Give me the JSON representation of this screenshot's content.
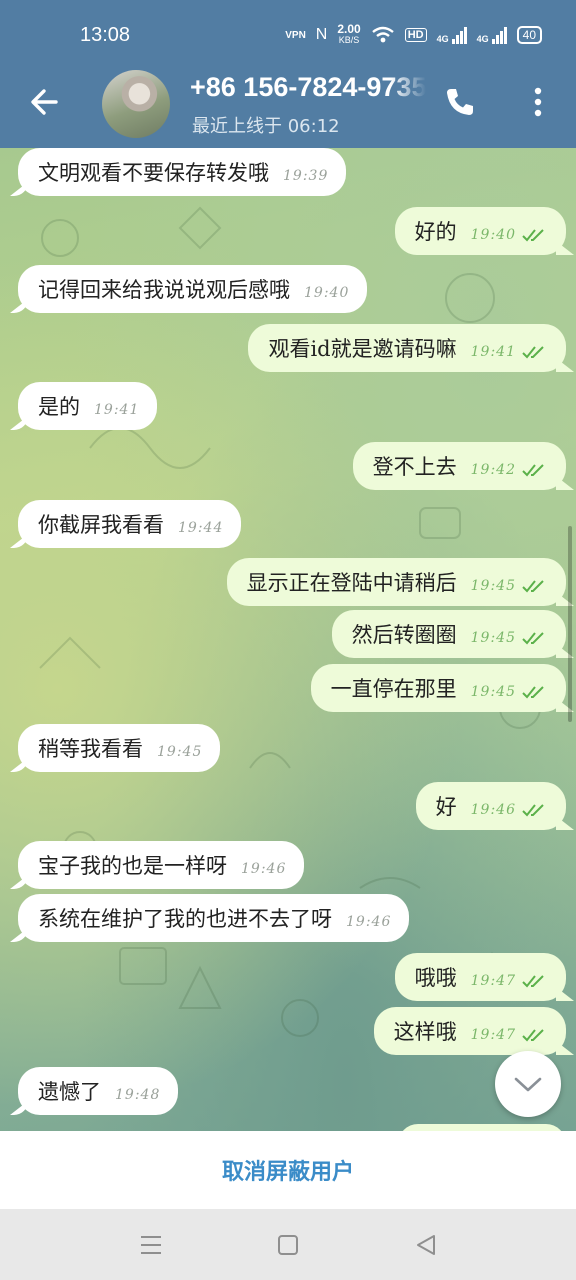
{
  "status": {
    "time": "13:08",
    "vpn": "VPN",
    "nfc": "N",
    "speed_value": "2.00",
    "speed_unit": "KB/S",
    "hd": "HD",
    "net1": "4G",
    "net2": "4G",
    "battery": "40"
  },
  "header": {
    "title": "+86 156-7824-9735",
    "subtitle": "最近上线于 06:12"
  },
  "messages": [
    {
      "dir": "in",
      "text": "文明观看不要保存转发哦",
      "time": "19:39"
    },
    {
      "dir": "out",
      "text": "好的",
      "time": "19:40",
      "read": true
    },
    {
      "dir": "in",
      "text": "记得回来给我说说观后感哦",
      "time": "19:40"
    },
    {
      "dir": "out",
      "text": "观看id就是邀请码嘛",
      "time": "19:41",
      "read": true
    },
    {
      "dir": "in",
      "text": "是的",
      "time": "19:41"
    },
    {
      "dir": "out",
      "text": "登不上去",
      "time": "19:42",
      "read": true
    },
    {
      "dir": "in",
      "text": "你截屏我看看",
      "time": "19:44"
    },
    {
      "dir": "out",
      "text": "显示正在登陆中请稍后",
      "time": "19:45",
      "read": true
    },
    {
      "dir": "out",
      "text": "然后转圈圈",
      "time": "19:45",
      "read": true
    },
    {
      "dir": "out",
      "text": "一直停在那里",
      "time": "19:45",
      "read": true
    },
    {
      "dir": "in",
      "text": "稍等我看看",
      "time": "19:45"
    },
    {
      "dir": "out",
      "text": "好",
      "time": "19:46",
      "read": true
    },
    {
      "dir": "in",
      "text": "宝子我的也是一样呀",
      "time": "19:46"
    },
    {
      "dir": "in",
      "text": "系统在维护了我的也进不去了呀",
      "time": "19:46"
    },
    {
      "dir": "out",
      "text": "哦哦",
      "time": "19:47",
      "read": true
    },
    {
      "dir": "out",
      "text": "这样哦",
      "time": "19:47",
      "read": true
    },
    {
      "dir": "in",
      "text": "遗憾了",
      "time": "19:48"
    }
  ],
  "bottom": {
    "unblock_label": "取消屏蔽用户"
  },
  "icons": {
    "back": "arrow-left-icon",
    "call": "phone-icon",
    "more": "more-vertical-icon",
    "scroll_down": "chevron-down-icon",
    "read": "double-check-icon"
  },
  "colors": {
    "header": "#527da3",
    "incoming_bubble": "#ffffff",
    "outgoing_bubble": "#eefbd9",
    "read_ticks": "#5bb14a",
    "unblock_text": "#3b8cc8"
  }
}
